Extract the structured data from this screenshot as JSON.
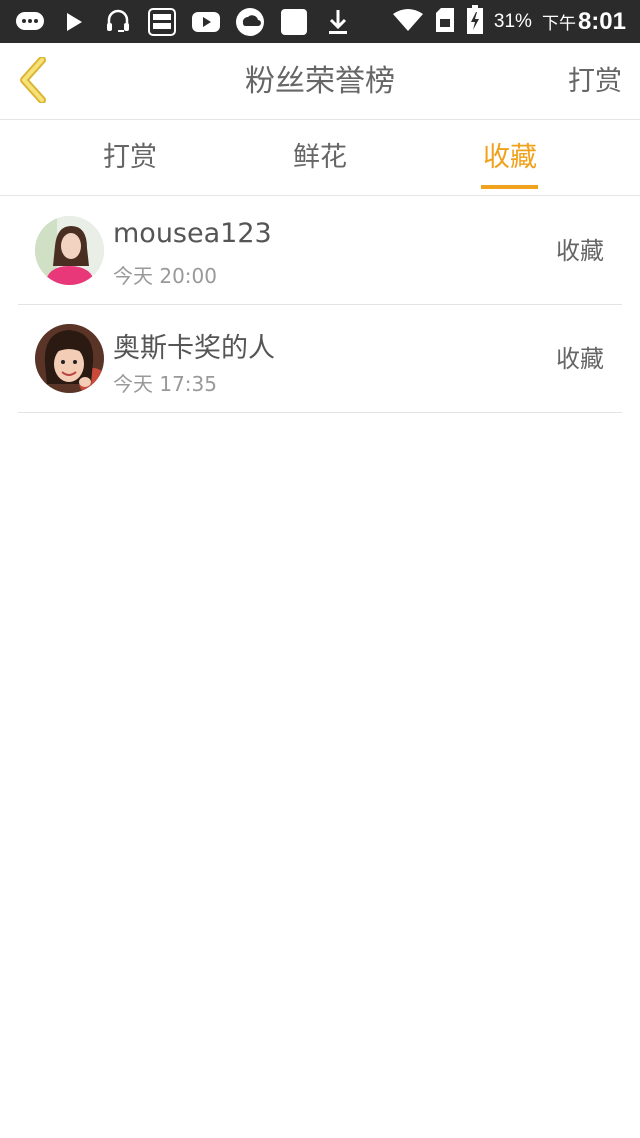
{
  "status_bar": {
    "icons": [
      "chat-bubble-icon",
      "play-icon",
      "headset-icon",
      "game-center-icon",
      "youtube-icon",
      "weather-icon",
      "blank-square-icon",
      "download-icon",
      "wifi-icon",
      "sim-card-icon",
      "battery-charging-icon"
    ],
    "battery": "31%",
    "ampm": "下午",
    "time": "8:01"
  },
  "header": {
    "title": "粉丝荣誉榜",
    "action_label": "打赏",
    "back_icon": "chevron-left-icon",
    "accent_color": "#f0a21c"
  },
  "tabs": [
    {
      "label": "打赏",
      "active": false
    },
    {
      "label": "鲜花",
      "active": false
    },
    {
      "label": "收藏",
      "active": true
    }
  ],
  "list": [
    {
      "name": "mousea123",
      "time": "今天 20:00",
      "action": "收藏"
    },
    {
      "name": "奥斯卡奖的人",
      "time": "今天 17:35",
      "action": "收藏"
    }
  ]
}
